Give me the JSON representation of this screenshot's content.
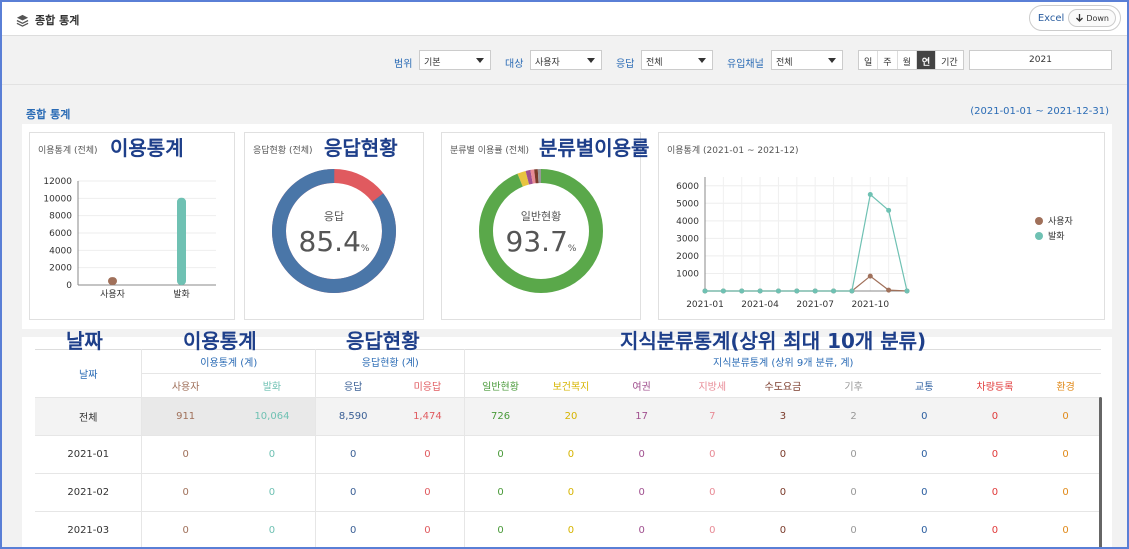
{
  "header": {
    "title": "종합 통계",
    "excel_label": "Excel",
    "down_label": "Down"
  },
  "filters": {
    "scope_label": "범위",
    "scope_value": "기본",
    "target_label": "대상",
    "target_value": "사용자",
    "response_label": "응답",
    "response_value": "전체",
    "channel_label": "유입채널",
    "channel_value": "전체",
    "periods": [
      "일",
      "주",
      "월",
      "연",
      "기간"
    ],
    "active_period": "연",
    "year_value": "2021"
  },
  "section": {
    "title": "종합 통계",
    "range": "(2021-01-01 ~ 2021-12-31)"
  },
  "cards": {
    "usage": {
      "title": "이용통계 (전체)",
      "overlay": "이용통계"
    },
    "response": {
      "title": "응답현황 (전체)",
      "overlay": "응답현황",
      "center_label": "응답",
      "value": "85.4",
      "unit": "%",
      "fraction": 0.854,
      "color_main": "#4a76a8",
      "color_rest": "#e05a5f"
    },
    "category": {
      "title": "분류별 이용률 (전체)",
      "overlay": "분류별이용률",
      "center_label": "일반현황",
      "value": "93.7",
      "unit": "%",
      "fraction": 0.937,
      "color_main": "#5aa84a"
    },
    "trend": {
      "title": "이용통계 (2021-01 ~ 2021-12)"
    }
  },
  "chart_data": [
    {
      "type": "bar",
      "categories": [
        "사용자",
        "발화"
      ],
      "values": [
        911,
        10064
      ],
      "ylim": [
        0,
        12000
      ],
      "yticks": [
        "0",
        "2000",
        "4000",
        "6000",
        "8000",
        "10000",
        "12000"
      ],
      "colors": [
        "#a0705a",
        "#6fc1b3"
      ]
    },
    {
      "type": "line",
      "x": [
        "2021-01",
        "2021-02",
        "2021-03",
        "2021-04",
        "2021-05",
        "2021-06",
        "2021-07",
        "2021-08",
        "2021-09",
        "2021-10",
        "2021-11",
        "2021-12"
      ],
      "xticks": [
        "2021-01",
        "2021-04",
        "2021-07",
        "2021-10"
      ],
      "yticks": [
        "1000",
        "2000",
        "3000",
        "4000",
        "5000",
        "6000"
      ],
      "ylim": [
        0,
        6500
      ],
      "series": [
        {
          "name": "사용자",
          "color": "#a0705a",
          "values": [
            0,
            0,
            0,
            0,
            0,
            0,
            0,
            0,
            0,
            850,
            50,
            0
          ]
        },
        {
          "name": "발화",
          "color": "#6fc1b3",
          "values": [
            0,
            0,
            0,
            0,
            0,
            0,
            0,
            0,
            0,
            5500,
            4600,
            0
          ]
        }
      ],
      "legend_position": "right"
    }
  ],
  "overlays": {
    "date": "날짜",
    "usage": "이용통계",
    "response": "응답현황",
    "knowledge": "지식분류통계(상위 최대 10개 분류)"
  },
  "table": {
    "date_header": "날짜",
    "group_usage": "이용통계 (계)",
    "group_response": "응답현황 (계)",
    "group_knowledge": "지식분류통계 (상위 9개 분류, 계)",
    "columns": [
      {
        "label": "사용자",
        "color": "#a0705a"
      },
      {
        "label": "발화",
        "color": "#6fc1b3"
      },
      {
        "label": "응답",
        "color": "#3a5f95"
      },
      {
        "label": "미응답",
        "color": "#e05a5f"
      },
      {
        "label": "일반현황",
        "color": "#4a9a3a"
      },
      {
        "label": "보건복지",
        "color": "#d6b400"
      },
      {
        "label": "여권",
        "color": "#a0508f"
      },
      {
        "label": "지방세",
        "color": "#e88a95"
      },
      {
        "label": "수도요금",
        "color": "#7a3a2a"
      },
      {
        "label": "기후",
        "color": "#999999"
      },
      {
        "label": "교통",
        "color": "#2a5d9f"
      },
      {
        "label": "차량등록",
        "color": "#e03a3a"
      },
      {
        "label": "환경",
        "color": "#e08a1a"
      }
    ],
    "rows": [
      {
        "date": "전체",
        "values": [
          "911",
          "10,064",
          "8,590",
          "1,474",
          "726",
          "20",
          "17",
          "7",
          "3",
          "2",
          "0",
          "0",
          "0"
        ]
      },
      {
        "date": "2021-01",
        "values": [
          "0",
          "0",
          "0",
          "0",
          "0",
          "0",
          "0",
          "0",
          "0",
          "0",
          "0",
          "0",
          "0"
        ]
      },
      {
        "date": "2021-02",
        "values": [
          "0",
          "0",
          "0",
          "0",
          "0",
          "0",
          "0",
          "0",
          "0",
          "0",
          "0",
          "0",
          "0"
        ]
      },
      {
        "date": "2021-03",
        "values": [
          "0",
          "0",
          "0",
          "0",
          "0",
          "0",
          "0",
          "0",
          "0",
          "0",
          "0",
          "0",
          "0"
        ]
      }
    ]
  }
}
